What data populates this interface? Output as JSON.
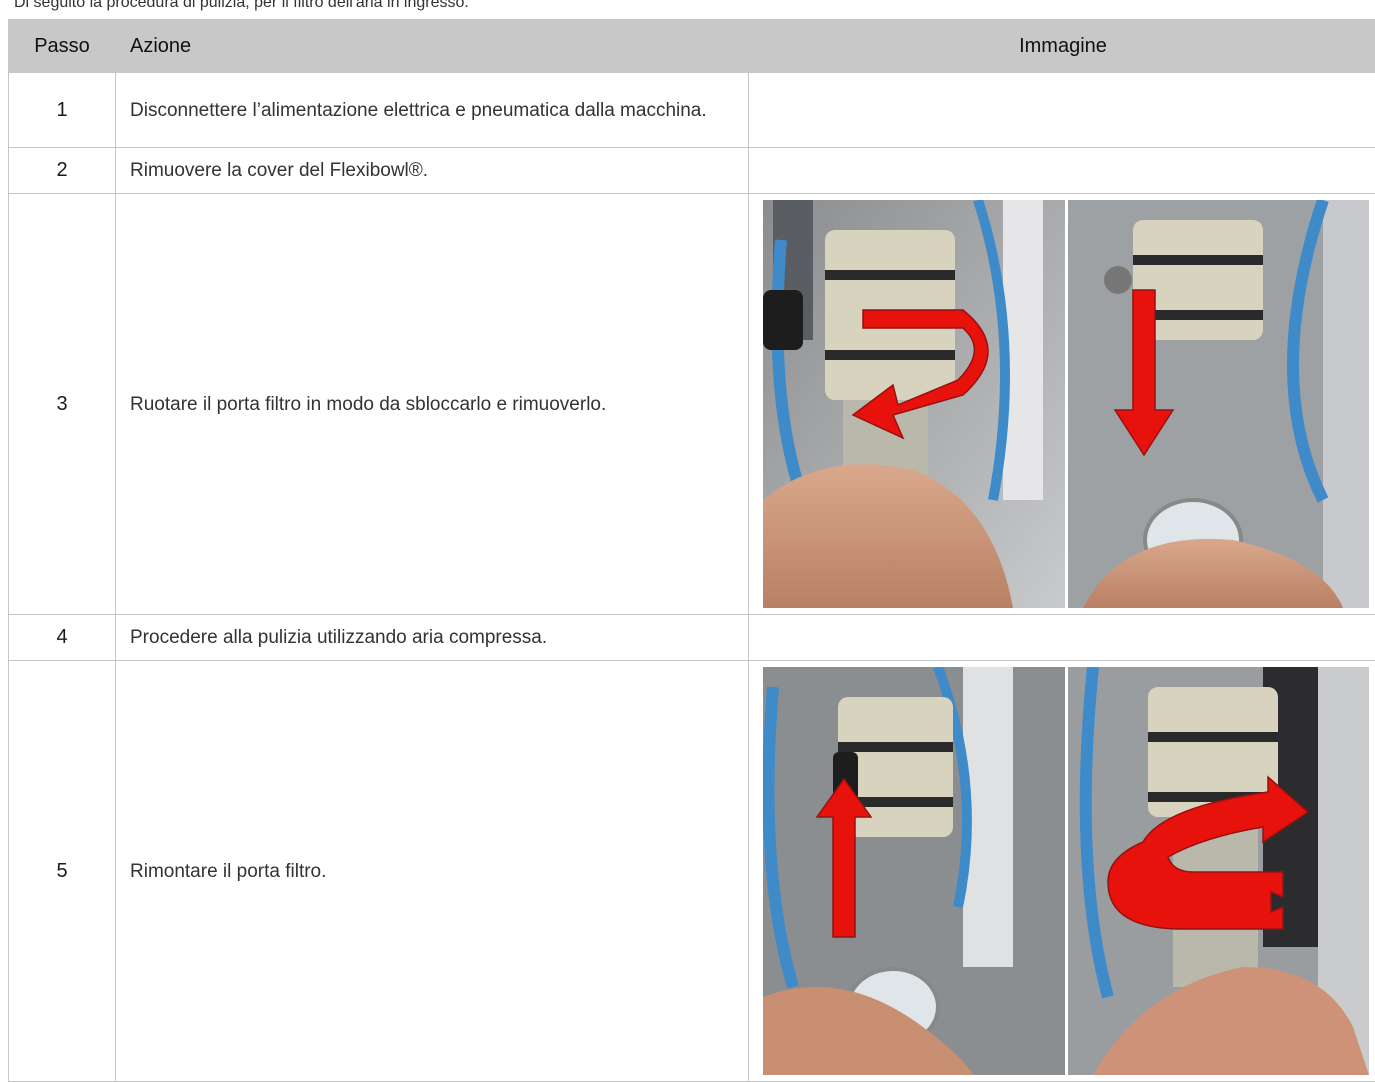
{
  "intro_text": "Di seguito la procedura di pulizia, per il filtro dell'aria in ingresso.",
  "table": {
    "headers": {
      "step": "Passo",
      "action": "Azione",
      "image": "Immagine"
    },
    "rows": [
      {
        "step": "1",
        "action": "Disconnettere l’alimentazione elettrica e pneumatica dalla macchina."
      },
      {
        "step": "2",
        "action": "Rimuovere la cover del Flexibowl®."
      },
      {
        "step": "3",
        "action": "Ruotare il porta filtro in modo da sbloccarlo e rimuoverlo."
      },
      {
        "step": "4",
        "action": "Procedere alla pulizia utilizzando aria compressa."
      },
      {
        "step": "5",
        "action": "Rimontare il porta filtro."
      }
    ]
  },
  "colors": {
    "header_bg": "#c8c8c8",
    "arrow_red": "#e8120c",
    "filter_body": "#d8d3bf",
    "tube_blue": "#4a8fc8"
  }
}
